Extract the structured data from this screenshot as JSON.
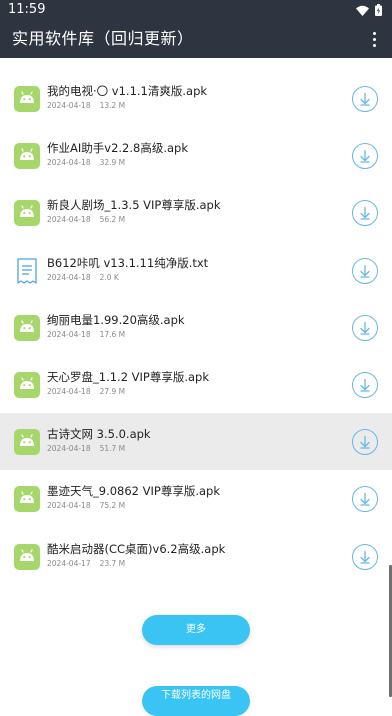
{
  "status_bar": {
    "time": "11:59",
    "wifi_icon": "wifi-icon",
    "battery_icon": "battery-icon"
  },
  "app_bar": {
    "title": "实用软件库（回归更新）",
    "menu_icon": "more-vert-icon"
  },
  "colors": {
    "app_bar": "#2f3441",
    "apk_icon": "#a7d76b",
    "txt_icon": "#4ea3e8",
    "download_ring": "#66b7e8",
    "primary_button": "#39c4f3",
    "selected_row": "#ebebeb"
  },
  "files": [
    {
      "name": "我的电视·〇 v1.1.1清爽版.apk",
      "date": "2024-04-18",
      "size": "13.2 M",
      "type": "apk",
      "selected": false
    },
    {
      "name": "作业AI助手v2.2.8高级.apk",
      "date": "2024-04-18",
      "size": "32.9 M",
      "type": "apk",
      "selected": false
    },
    {
      "name": "新良人剧场_1.3.5 VIP尊享版.apk",
      "date": "2024-04-18",
      "size": "56.2 M",
      "type": "apk",
      "selected": false
    },
    {
      "name": "B612咔叽 v13.1.11纯净版.txt",
      "date": "2024-04-18",
      "size": "2.0 K",
      "type": "txt",
      "selected": false
    },
    {
      "name": "绚丽电量1.99.20高级.apk",
      "date": "2024-04-18",
      "size": "17.6 M",
      "type": "apk",
      "selected": false
    },
    {
      "name": "天心罗盘_1.1.2 VIP尊享版.apk",
      "date": "2024-04-18",
      "size": "27.9 M",
      "type": "apk",
      "selected": false
    },
    {
      "name": "古诗文网 3.5.0.apk",
      "date": "2024-04-18",
      "size": "51.7 M",
      "type": "apk",
      "selected": true
    },
    {
      "name": "墨迹天气_9.0862 VIP尊享版.apk",
      "date": "2024-04-18",
      "size": "75.2 M",
      "type": "apk",
      "selected": false
    },
    {
      "name": "酷米启动器(CC桌面)v6.2高级.apk",
      "date": "2024-04-17",
      "size": "23.7 M",
      "type": "apk",
      "selected": false
    }
  ],
  "buttons": {
    "more_label": "更多",
    "next_label": "下载列表的网盘"
  }
}
